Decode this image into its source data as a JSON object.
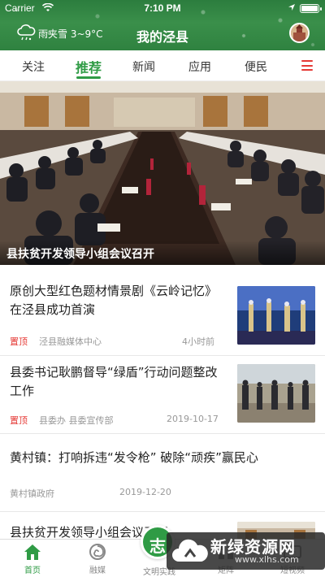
{
  "status": {
    "carrier": "Carrier",
    "time": "7:10 PM"
  },
  "header": {
    "weather": "雨夹雪 3~9°C",
    "title": "我的泾县"
  },
  "tabs": [
    {
      "label": "关注",
      "active": false
    },
    {
      "label": "推荐",
      "active": true
    },
    {
      "label": "新闻",
      "active": false
    },
    {
      "label": "应用",
      "active": false
    },
    {
      "label": "便民",
      "active": false
    }
  ],
  "hero": {
    "caption": "县扶贫开发领导小组会议召开"
  },
  "news": [
    {
      "title": "原创大型红色题材情景剧《云岭记忆》在泾县成功首演",
      "tag": "置顶",
      "source": "泾县融媒体中心",
      "time": "4小时前"
    },
    {
      "title": "县委书记耿鹏督导“绿盾”行动问题整改工作",
      "tag": "置顶",
      "source": "县委办 县委宣传部",
      "time": "2019-10-17"
    },
    {
      "title": "黄村镇：打响拆违“发令枪” 破除“顽疾”赢民心",
      "tag": "",
      "source": "黄村镇政府",
      "time": "2019-12-20"
    },
    {
      "title": "县扶贫开发领导小组会议召开",
      "tag": "",
      "source": "",
      "time": ""
    }
  ],
  "bottom_nav": [
    {
      "label": "首页",
      "icon": "home-icon",
      "active": true
    },
    {
      "label": "融媒",
      "icon": "swirl-icon",
      "active": false
    },
    {
      "label": "文明实践",
      "icon": "practice-icon",
      "active": false
    },
    {
      "label": "矩阵",
      "icon": "matrix-icon",
      "active": false
    },
    {
      "label": "短视频",
      "icon": "video-icon",
      "active": false
    }
  ],
  "center_button": {
    "char": "志"
  },
  "watermark": {
    "title": "新绿资源网",
    "url": "www.xlhs.com"
  },
  "colors": {
    "accent": "#2f9b45",
    "tag_red": "#e53935"
  }
}
